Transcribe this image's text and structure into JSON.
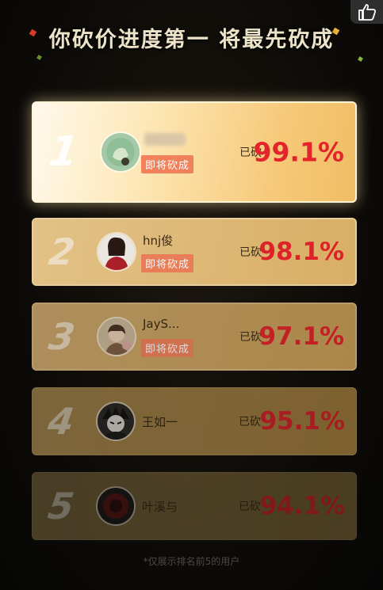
{
  "header": {
    "title": "你砍价进度第一 将最先砍成"
  },
  "ranking": [
    {
      "rank": "1",
      "name": "",
      "badge": "即将砍成",
      "cut_label": "已砍",
      "cut_value": "99.1%"
    },
    {
      "rank": "2",
      "name": "hnj俊",
      "badge": "即将砍成",
      "cut_label": "已砍",
      "cut_value": "98.1%"
    },
    {
      "rank": "3",
      "name": "JayS...",
      "badge": "即将砍成",
      "cut_label": "已砍",
      "cut_value": "97.1%"
    },
    {
      "rank": "4",
      "name": "王如一",
      "badge": "",
      "cut_label": "已砍",
      "cut_value": "95.1%"
    },
    {
      "rank": "5",
      "name": "叶溪与",
      "badge": "",
      "cut_label": "已砍",
      "cut_value": "94.1%"
    }
  ],
  "footer": {
    "note": "*仅展示排名前5的用户"
  },
  "colors": {
    "accent_red": "#e3242b",
    "badge_orange": "#f0815a",
    "title_text": "#ece3c8"
  },
  "icons": [
    "thumbs-up-icon",
    "avatar-icon"
  ]
}
